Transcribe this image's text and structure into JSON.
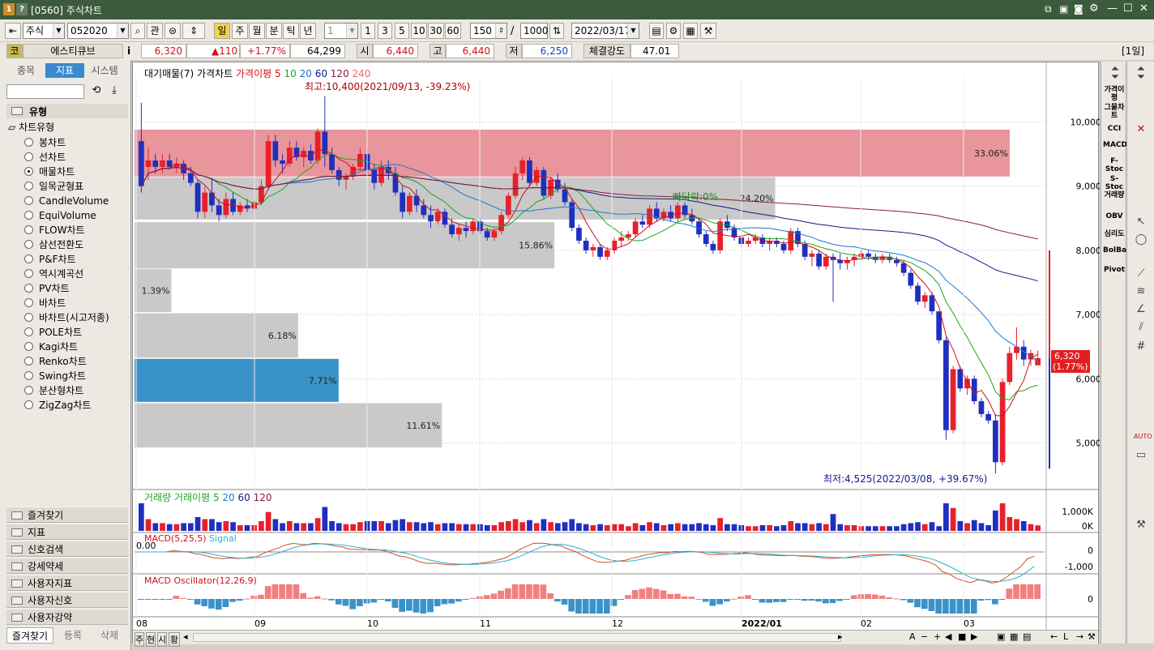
{
  "window": {
    "title": "[0560] 주식차트",
    "left_badges": [
      "1",
      "?"
    ]
  },
  "toolbar": {
    "market": "주식",
    "code": "052020",
    "btn_gwan": "관",
    "periods": [
      "일",
      "주",
      "월",
      "분",
      "틱",
      "년"
    ],
    "active_period": "일",
    "interval": "1",
    "interval_quick": [
      "1",
      "3",
      "5",
      "10",
      "30",
      "60"
    ],
    "count": "150",
    "slash": "/",
    "total": "1000",
    "date": "2022/03/17"
  },
  "quote": {
    "market_badge": "코",
    "name": "에스티큐브",
    "info": "i",
    "price": "6,320",
    "change": "▲110",
    "change_pct": "+1.77%",
    "volume": "64,299",
    "open_label": "시",
    "open": "6,440",
    "high_label": "고",
    "high": "6,440",
    "low_label": "저",
    "low": "6,250",
    "strength_label": "체결강도",
    "strength": "47.01",
    "period_badge": "[1일]"
  },
  "left_panel": {
    "tabs": [
      "종목",
      "지표",
      "시스템"
    ],
    "active_tab": "지표",
    "section_title": "유형",
    "tree_root": "차트유형",
    "chart_types": [
      "봉차트",
      "선차트",
      "매물차트",
      "일목균형표",
      "CandleVolume",
      "EquiVolume",
      "FLOW차트",
      "삼선전환도",
      "P&F차트",
      "역시계곡선",
      "PV차트",
      "바차트",
      "바차트(시고저종)",
      "POLE차트",
      "Kagi차트",
      "Renko차트",
      "Swing차트",
      "분산형차트",
      "ZigZag차트"
    ],
    "selected_type": "매물차트",
    "accordion": [
      "즐겨찾기",
      "지표",
      "신호검색",
      "강세약세",
      "사용자지표",
      "사용자신호",
      "사용자강약"
    ],
    "bottom_tabs": [
      "즐겨찾기",
      "등록",
      "삭제"
    ]
  },
  "main_legend": {
    "vp": "대기매물(7)",
    "price": "가격차트",
    "ma_label": "가격이평",
    "ma_periods": [
      "5",
      "10",
      "20",
      "60",
      "120",
      "240"
    ]
  },
  "annotations": {
    "high": "최고:10,400(2021/09/13, -39.23%)",
    "low": "최저:4,525(2022/03/08, +39.67%)",
    "center": "빠닥락:0%"
  },
  "volume_legend": {
    "label": "거래량",
    "ma_label": "거래이평",
    "ma_periods": [
      "5",
      "20",
      "60",
      "120"
    ]
  },
  "macd_legend": {
    "label": "MACD(5,25,5)",
    "signal": "Signal"
  },
  "osc_legend": {
    "label": "MACD Oscillator(12,26,9)"
  },
  "axis": {
    "price_ticks": [
      "10,000",
      "9,000",
      "8,000",
      "7,000",
      "6,000",
      "5,000"
    ],
    "volume_ticks": [
      "1,000K",
      "0K"
    ],
    "macd_ticks": [
      "0",
      "-1,000"
    ],
    "macd_zero": "0.00",
    "osc_ticks": [
      "0"
    ],
    "current_price": "6,320",
    "current_change": "(1.77%)",
    "months": [
      "08",
      "09",
      "10",
      "11",
      "12",
      "2022/01",
      "02",
      "03"
    ]
  },
  "sidebar_indicators": [
    "가격이평",
    "그물차트",
    "CCI",
    "MACD",
    "F-Stoc",
    "S-Stoc",
    "거래량",
    "OBV",
    "심리도",
    "BolBand",
    "Pivot"
  ],
  "bottom_tabs": [
    "주",
    "현",
    "시",
    "황"
  ],
  "colors": {
    "up": "#e8202a",
    "down": "#1f2fc0",
    "vp_high": "#e8959c",
    "vp_gray": "#c9c9c9",
    "vp_current": "#3a93c8",
    "titlebar": "#3c5a3c"
  },
  "chart_data": {
    "type": "candlestick",
    "volume_profile": [
      {
        "label": "33.06%",
        "pct": 33.06,
        "from": 9150,
        "to": 9880
      },
      {
        "label": "24.20%",
        "pct": 24.2,
        "from": 8480,
        "to": 9140
      },
      {
        "label": "15.86%",
        "pct": 15.86,
        "from": 7720,
        "to": 8440
      },
      {
        "label": "1.39%",
        "pct": 1.39,
        "from": 7040,
        "to": 7710
      },
      {
        "label": "6.18%",
        "pct": 6.18,
        "from": 6330,
        "to": 7020
      },
      {
        "label": "7.71%",
        "pct": 7.71,
        "from": 5640,
        "to": 6310
      },
      {
        "label": "11.61%",
        "pct": 11.61,
        "from": 4930,
        "to": 5620
      }
    ],
    "ohlc": [
      [
        9700,
        10300,
        8900,
        9000
      ],
      [
        9300,
        9600,
        9100,
        9400
      ],
      [
        9400,
        9500,
        9200,
        9300
      ],
      [
        9300,
        9500,
        9200,
        9400
      ],
      [
        9400,
        9500,
        9250,
        9300
      ],
      [
        9300,
        9450,
        9200,
        9350
      ],
      [
        9350,
        9400,
        9100,
        9200
      ],
      [
        9200,
        9300,
        9000,
        9050
      ],
      [
        9050,
        9100,
        8500,
        8600
      ],
      [
        8600,
        9000,
        8500,
        8900
      ],
      [
        8900,
        9100,
        8600,
        8700
      ],
      [
        8700,
        8800,
        8450,
        8550
      ],
      [
        8550,
        8900,
        8500,
        8800
      ],
      [
        8800,
        8900,
        8550,
        8600
      ],
      [
        8600,
        8750,
        8550,
        8700
      ],
      [
        8700,
        8800,
        8600,
        8650
      ],
      [
        8650,
        8800,
        8600,
        8750
      ],
      [
        8750,
        9100,
        8700,
        9000
      ],
      [
        9000,
        9800,
        8950,
        9700
      ],
      [
        9700,
        9800,
        9300,
        9400
      ],
      [
        9400,
        9500,
        9200,
        9350
      ],
      [
        9350,
        9700,
        9300,
        9600
      ],
      [
        9600,
        9700,
        9400,
        9450
      ],
      [
        9450,
        9600,
        9300,
        9550
      ],
      [
        9550,
        9650,
        9350,
        9400
      ],
      [
        9400,
        9900,
        9350,
        9850
      ],
      [
        9850,
        10400,
        9300,
        9500
      ],
      [
        9500,
        9600,
        9200,
        9250
      ],
      [
        9250,
        9300,
        9000,
        9100
      ],
      [
        9100,
        9200,
        8950,
        9150
      ],
      [
        9150,
        9350,
        9100,
        9300
      ],
      [
        9300,
        9600,
        9250,
        9500
      ],
      [
        9500,
        9600,
        9200,
        9250
      ],
      [
        9250,
        9350,
        8950,
        9050
      ],
      [
        9050,
        9400,
        9000,
        9300
      ],
      [
        9300,
        9400,
        9100,
        9200
      ],
      [
        9200,
        9300,
        8850,
        8900
      ],
      [
        8900,
        9000,
        8500,
        8600
      ],
      [
        8600,
        8900,
        8550,
        8850
      ],
      [
        8850,
        8950,
        8600,
        8700
      ],
      [
        8700,
        8800,
        8500,
        8550
      ],
      [
        8550,
        8700,
        8350,
        8450
      ],
      [
        8450,
        8650,
        8400,
        8600
      ],
      [
        8600,
        8650,
        8350,
        8400
      ],
      [
        8400,
        8500,
        8200,
        8250
      ],
      [
        8250,
        8400,
        8150,
        8350
      ],
      [
        8350,
        8450,
        8200,
        8300
      ],
      [
        8300,
        8500,
        8250,
        8450
      ],
      [
        8450,
        8500,
        8250,
        8300
      ],
      [
        8300,
        8350,
        8150,
        8200
      ],
      [
        8200,
        8350,
        8150,
        8300
      ],
      [
        8300,
        8600,
        8250,
        8550
      ],
      [
        8550,
        8900,
        8500,
        8850
      ],
      [
        8850,
        9300,
        8800,
        9200
      ],
      [
        9200,
        9450,
        9100,
        9400
      ],
      [
        9400,
        9450,
        9000,
        9050
      ],
      [
        9050,
        9300,
        9000,
        9250
      ],
      [
        9250,
        9300,
        8800,
        8850
      ],
      [
        8850,
        9150,
        8800,
        9100
      ],
      [
        9100,
        9200,
        8900,
        8950
      ],
      [
        8950,
        9050,
        8700,
        8750
      ],
      [
        8750,
        8800,
        8300,
        8350
      ],
      [
        8350,
        8400,
        8100,
        8150
      ],
      [
        8150,
        8200,
        7950,
        8000
      ],
      [
        8000,
        8100,
        7900,
        8050
      ],
      [
        8050,
        8100,
        7850,
        7900
      ],
      [
        7900,
        8050,
        7850,
        8000
      ],
      [
        8000,
        8200,
        7950,
        8150
      ],
      [
        8150,
        8300,
        8050,
        8200
      ],
      [
        8200,
        8300,
        8150,
        8250
      ],
      [
        8250,
        8500,
        8200,
        8450
      ],
      [
        8450,
        8550,
        8350,
        8400
      ],
      [
        8400,
        8700,
        8350,
        8650
      ],
      [
        8650,
        8750,
        8450,
        8500
      ],
      [
        8500,
        8650,
        8450,
        8600
      ],
      [
        8600,
        8700,
        8450,
        8500
      ],
      [
        8500,
        8750,
        8450,
        8700
      ],
      [
        8700,
        8750,
        8500,
        8550
      ],
      [
        8550,
        8650,
        8400,
        8450
      ],
      [
        8450,
        8500,
        8200,
        8250
      ],
      [
        8250,
        8300,
        8050,
        8100
      ],
      [
        8100,
        8150,
        7950,
        8000
      ],
      [
        8000,
        8500,
        7950,
        8450
      ],
      [
        8450,
        8550,
        8300,
        8350
      ],
      [
        8350,
        8400,
        8150,
        8200
      ],
      [
        8200,
        8250,
        8050,
        8100
      ],
      [
        8100,
        8200,
        8050,
        8150
      ],
      [
        8150,
        8250,
        8100,
        8200
      ],
      [
        8200,
        8250,
        8050,
        8100
      ],
      [
        8100,
        8200,
        8000,
        8150
      ],
      [
        8150,
        8200,
        8050,
        8100
      ],
      [
        8100,
        8150,
        7950,
        8000
      ],
      [
        8000,
        8350,
        7950,
        8300
      ],
      [
        8300,
        8350,
        8050,
        8100
      ],
      [
        8100,
        8150,
        7850,
        7900
      ],
      [
        7900,
        8000,
        7750,
        7950
      ],
      [
        7950,
        8000,
        7700,
        7750
      ],
      [
        7750,
        7950,
        7700,
        7900
      ],
      [
        7900,
        7950,
        7200,
        7850
      ],
      [
        7850,
        7950,
        7700,
        7800
      ],
      [
        7800,
        7900,
        7700,
        7850
      ],
      [
        7850,
        7950,
        7750,
        7900
      ],
      [
        7900,
        8000,
        7850,
        7950
      ],
      [
        7950,
        8000,
        7850,
        7900
      ],
      [
        7900,
        7950,
        7800,
        7850
      ],
      [
        7850,
        7950,
        7800,
        7900
      ],
      [
        7900,
        7950,
        7800,
        7850
      ],
      [
        7850,
        7900,
        7750,
        7800
      ],
      [
        7800,
        7850,
        7600,
        7650
      ],
      [
        7650,
        7700,
        7400,
        7450
      ],
      [
        7450,
        7500,
        7150,
        7200
      ],
      [
        7200,
        7350,
        7100,
        7300
      ],
      [
        7300,
        7350,
        7000,
        7050
      ],
      [
        7050,
        6700,
        6550,
        6600
      ],
      [
        6600,
        6650,
        5050,
        5200
      ],
      [
        5200,
        6200,
        5150,
        6150
      ],
      [
        6150,
        6200,
        5800,
        5850
      ],
      [
        5850,
        6050,
        5750,
        6000
      ],
      [
        6000,
        6050,
        5600,
        5650
      ],
      [
        5650,
        5700,
        5400,
        5450
      ],
      [
        5450,
        5500,
        5300,
        5350
      ],
      [
        5350,
        5450,
        4525,
        4700
      ],
      [
        4700,
        6000,
        4650,
        5950
      ],
      [
        5950,
        6500,
        5900,
        6400
      ],
      [
        6400,
        6800,
        6300,
        6500
      ],
      [
        6500,
        6600,
        6200,
        6300
      ],
      [
        6300,
        6450,
        6200,
        6400
      ],
      [
        6210,
        6440,
        6250,
        6320
      ]
    ],
    "price_range": [
      4300,
      10700
    ]
  }
}
